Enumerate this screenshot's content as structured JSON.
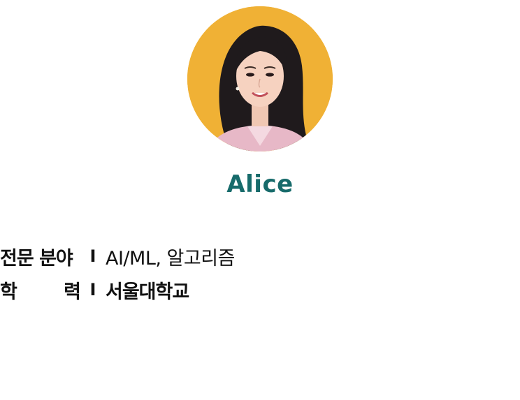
{
  "profile": {
    "name": "Alice",
    "photo_icon": "person-portrait-icon",
    "photo_bg_color": "#f0b135",
    "name_color": "#176b6b"
  },
  "info": {
    "separator": "I",
    "rows": [
      {
        "label": "전문 분야",
        "value": "AI/ML, 알고리즘"
      },
      {
        "label_first": "학",
        "label_last": "력",
        "value": "서울대학교"
      }
    ]
  }
}
